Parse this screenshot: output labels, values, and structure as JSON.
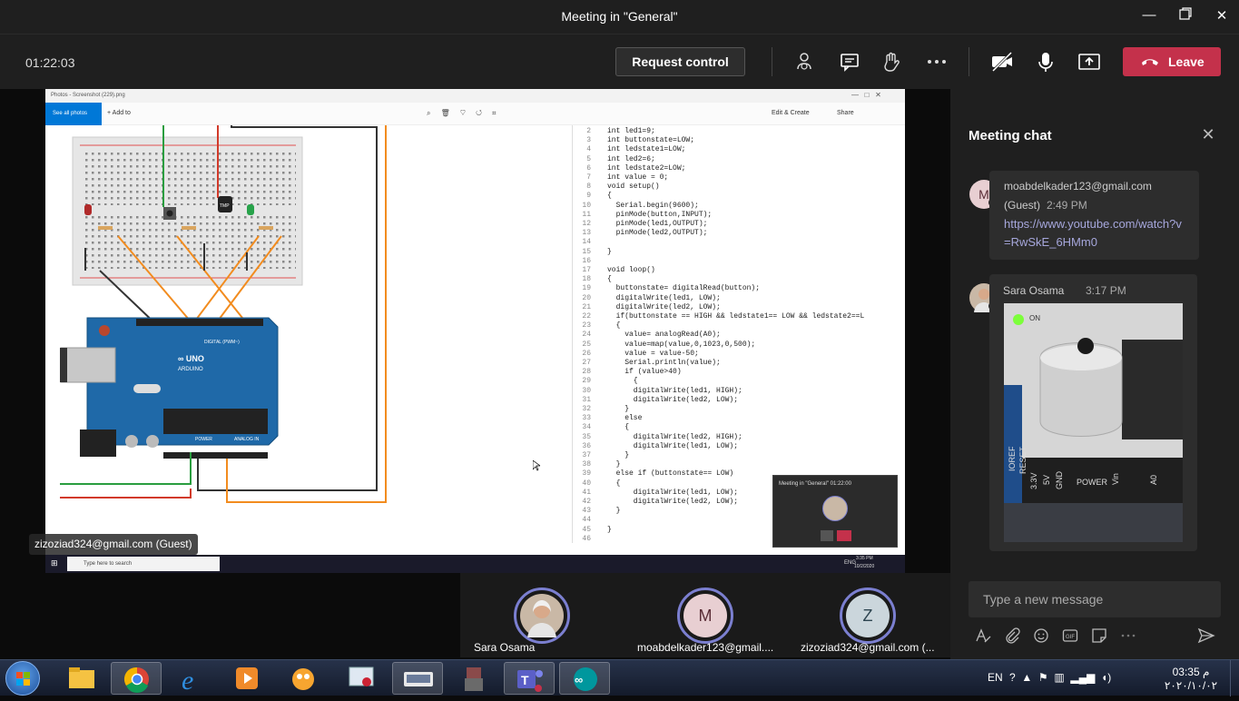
{
  "window": {
    "title": "Meeting in \"General\""
  },
  "toolbar": {
    "timer": "01:22:03",
    "request_control": "Request control",
    "leave": "Leave"
  },
  "shared_screen": {
    "photos_title": "Photos - Screenshot (229).png",
    "see_all": "See all photos",
    "add_to": "+ Add to",
    "edit_create": "Edit & Create",
    "share": "Share",
    "code_lines": [
      {
        "n": "2",
        "t": "int led1=9;"
      },
      {
        "n": "3",
        "t": "int buttonstate=LOW;"
      },
      {
        "n": "4",
        "t": "int ledstate1=LOW;"
      },
      {
        "n": "5",
        "t": "int led2=6;"
      },
      {
        "n": "6",
        "t": "int ledstate2=LOW;"
      },
      {
        "n": "7",
        "t": "int value = 0;"
      },
      {
        "n": "8",
        "t": "void setup()"
      },
      {
        "n": "9",
        "t": "{"
      },
      {
        "n": "10",
        "t": "  Serial.begin(9600);"
      },
      {
        "n": "11",
        "t": "  pinMode(button,INPUT);"
      },
      {
        "n": "12",
        "t": "  pinMode(led1,OUTPUT);"
      },
      {
        "n": "13",
        "t": "  pinMode(led2,OUTPUT);"
      },
      {
        "n": "14",
        "t": ""
      },
      {
        "n": "15",
        "t": "}"
      },
      {
        "n": "16",
        "t": ""
      },
      {
        "n": "17",
        "t": "void loop()"
      },
      {
        "n": "18",
        "t": "{"
      },
      {
        "n": "19",
        "t": "  buttonstate= digitalRead(button);"
      },
      {
        "n": "20",
        "t": "  digitalWrite(led1, LOW);"
      },
      {
        "n": "21",
        "t": "  digitalWrite(led2, LOW);"
      },
      {
        "n": "22",
        "t": "  if(buttonstate == HIGH && ledstate1== LOW && ledstate2==L"
      },
      {
        "n": "23",
        "t": "  {"
      },
      {
        "n": "24",
        "t": "    value= analogRead(A0);"
      },
      {
        "n": "25",
        "t": "    value=map(value,0,1023,0,500);"
      },
      {
        "n": "26",
        "t": "    value = value-50;"
      },
      {
        "n": "27",
        "t": "    Serial.println(value);"
      },
      {
        "n": "28",
        "t": "    if (value>40)"
      },
      {
        "n": "29",
        "t": "      {"
      },
      {
        "n": "30",
        "t": "      digitalWrite(led1, HIGH);"
      },
      {
        "n": "31",
        "t": "      digitalWrite(led2, LOW);"
      },
      {
        "n": "32",
        "t": "    }"
      },
      {
        "n": "33",
        "t": "    else"
      },
      {
        "n": "34",
        "t": "    {"
      },
      {
        "n": "35",
        "t": "      digitalWrite(led2, HIGH);"
      },
      {
        "n": "36",
        "t": "      digitalWrite(led1, LOW);"
      },
      {
        "n": "37",
        "t": "    }"
      },
      {
        "n": "38",
        "t": "  }"
      },
      {
        "n": "39",
        "t": "  else if (buttonstate== LOW)"
      },
      {
        "n": "40",
        "t": "  {"
      },
      {
        "n": "41",
        "t": "      digitalWrite(led1, LOW);"
      },
      {
        "n": "42",
        "t": "      digitalWrite(led2, LOW);"
      },
      {
        "n": "43",
        "t": "  }"
      },
      {
        "n": "44",
        "t": ""
      },
      {
        "n": "45",
        "t": "}"
      },
      {
        "n": "46",
        "t": ""
      }
    ],
    "taskbar_search": "Type here to search",
    "taskbar_lang": "ENG",
    "taskbar_time": "3:35 PM",
    "taskbar_date": "10/2/2020",
    "guest_label": "zizoziad324@gmail.com (Guest)",
    "mini_call_title": "Meeting in \"General\"   01:22:00"
  },
  "participants": [
    {
      "name": "Sara Osama",
      "initial": "",
      "color": "#c9b8a6"
    },
    {
      "name": "moabdelkader123@gmail....",
      "initial": "M",
      "color": "#e8cfd2"
    },
    {
      "name": "zizoziad324@gmail.com (...",
      "initial": "Z",
      "color": "#cbd6dc"
    }
  ],
  "chat": {
    "title": "Meeting chat",
    "messages": [
      {
        "initial": "M",
        "sender": "moabdelkader123@gmail.com",
        "guest": "(Guest)",
        "time": "2:49 PM",
        "text": "https://www.youtube.com/watch?v=RwSkE_6HMm0"
      },
      {
        "sender": "Sara Osama",
        "time": "3:17 PM",
        "photo_labels": [
          "IOREF",
          "RESET",
          "3.3V",
          "5V",
          "GND",
          "POWER",
          "Vin",
          "A0",
          "ON"
        ]
      }
    ],
    "compose_placeholder": "Type a new message"
  },
  "taskbar": {
    "lang": "EN",
    "time": "03:35 م",
    "date": "٢٠٢٠/١٠/٠٢"
  },
  "colors": {
    "accent": "#6264a7",
    "leave": "#c4314b",
    "link": "#a6a7dc",
    "arduino": "#1f69a8"
  }
}
